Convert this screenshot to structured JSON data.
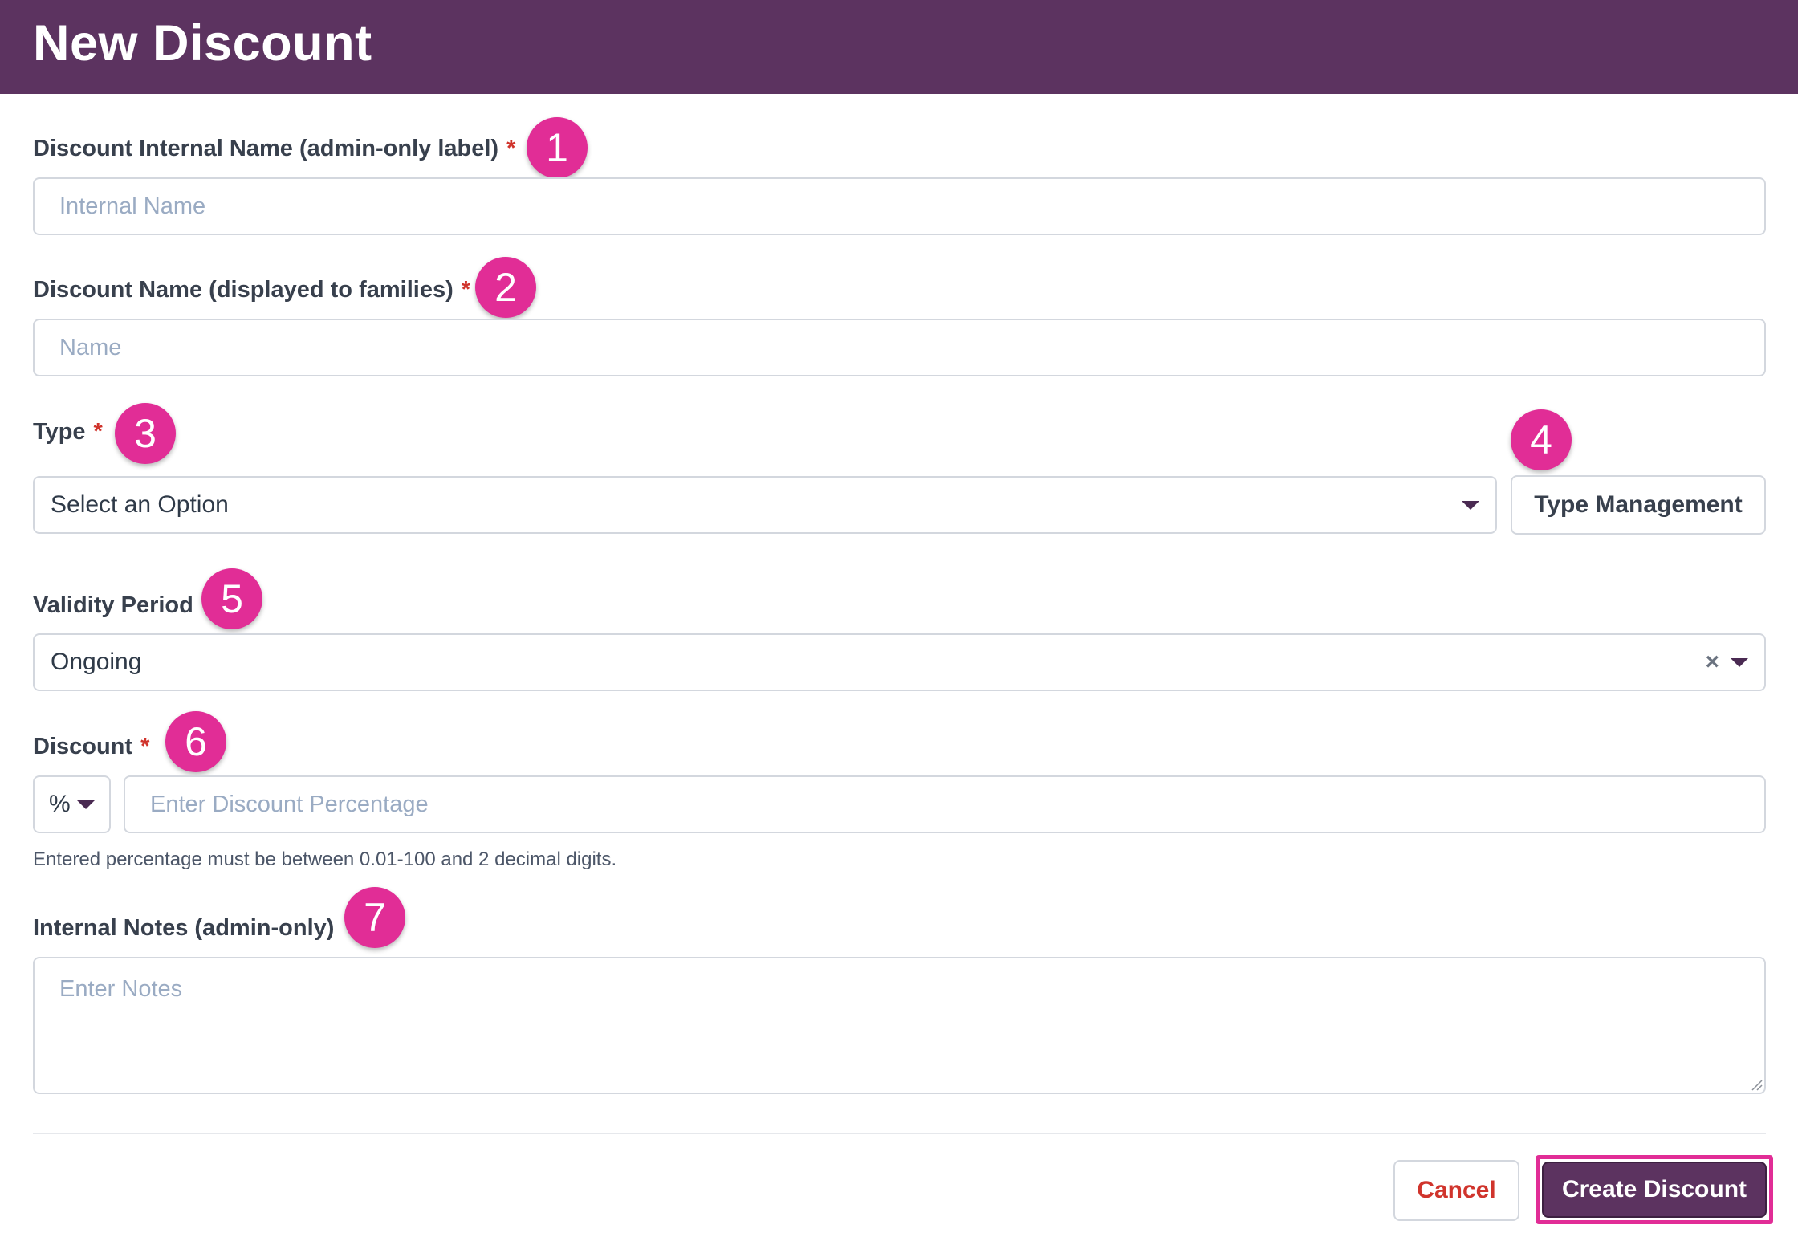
{
  "header": {
    "title": "New Discount"
  },
  "fields": {
    "internal_name": {
      "label": "Discount Internal Name (admin-only label)",
      "required_mark": "*",
      "placeholder": "Internal Name",
      "badge": "1"
    },
    "name": {
      "label": "Discount Name (displayed to families)",
      "required_mark": "*",
      "placeholder": "Name",
      "badge": "2"
    },
    "type": {
      "label": "Type",
      "required_mark": "*",
      "selected": "Select an Option",
      "badge": "3"
    },
    "type_management": {
      "label": "Type Management",
      "badge": "4"
    },
    "validity_period": {
      "label": "Validity Period",
      "selected": "Ongoing",
      "clear_symbol": "×",
      "badge": "5"
    },
    "discount": {
      "label": "Discount",
      "required_mark": "*",
      "unit": "%",
      "placeholder": "Enter Discount Percentage",
      "hint": "Entered percentage must be between 0.01-100 and 2 decimal digits.",
      "badge": "6"
    },
    "internal_notes": {
      "label": "Internal Notes (admin-only)",
      "placeholder": "Enter Notes",
      "badge": "7"
    }
  },
  "actions": {
    "cancel": "Cancel",
    "create": "Create Discount"
  },
  "colors": {
    "header_bg": "#5c3360",
    "badge": "#e12d96",
    "required": "#d0342c",
    "highlight": "#e12d96"
  }
}
